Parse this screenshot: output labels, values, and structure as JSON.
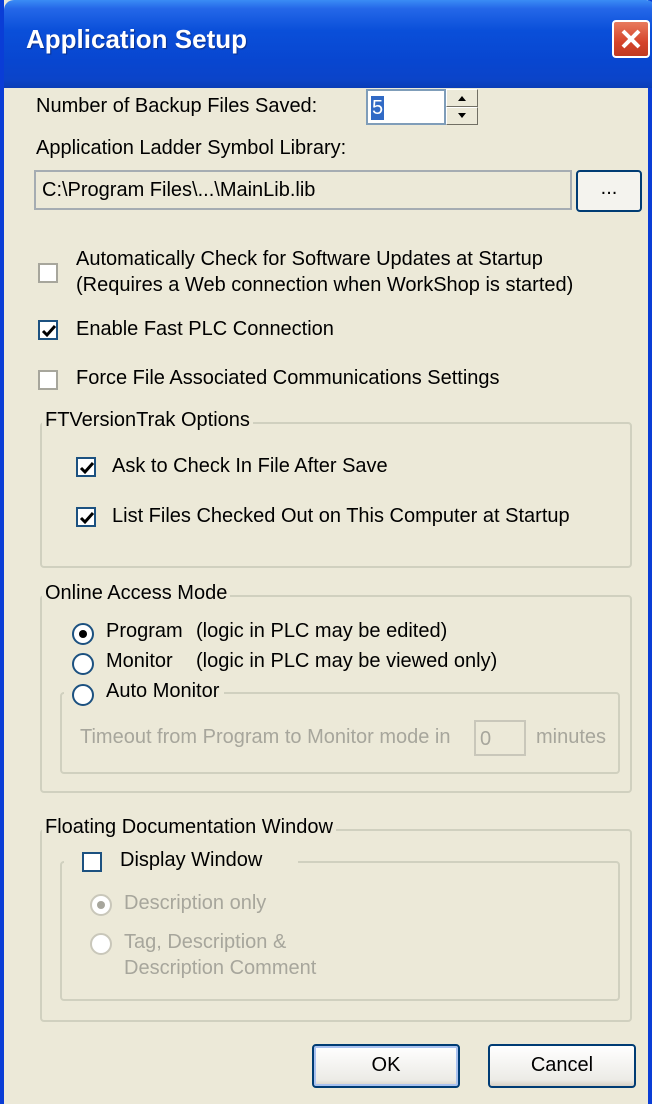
{
  "window": {
    "title": "Application Setup"
  },
  "backup": {
    "label": "Number of Backup Files Saved:",
    "value": "5"
  },
  "library": {
    "label": "Application Ladder Symbol Library:",
    "path": "C:\\Program Files\\...\\MainLib.lib",
    "browse_label": "..."
  },
  "options": {
    "auto_update": {
      "label_line1": "Automatically Check for Software Updates at Startup",
      "label_line2": "(Requires a Web connection when WorkShop is started)",
      "checked": false
    },
    "fast_plc": {
      "label": "Enable Fast PLC Connection",
      "checked": true
    },
    "force_file": {
      "label": "Force File Associated Communications Settings",
      "checked": false
    }
  },
  "ftversiontrak": {
    "title": "FTVersionTrak Options",
    "checkin": {
      "label": "Ask to Check In File After Save",
      "checked": true
    },
    "list_files": {
      "label": "List Files Checked Out on This Computer at Startup",
      "checked": true
    }
  },
  "online_access": {
    "title": "Online Access Mode",
    "program": {
      "label": "Program",
      "desc": "(logic in PLC may be edited)",
      "selected": true
    },
    "monitor": {
      "label": "Monitor",
      "desc": "(logic in PLC may be viewed only)",
      "selected": false
    },
    "auto_monitor": {
      "label": "Auto Monitor",
      "selected": false
    },
    "timeout_label": "Timeout from Program to Monitor mode in",
    "timeout_value": "0",
    "timeout_unit": "minutes"
  },
  "floating_doc": {
    "title": "Floating Documentation Window",
    "display": {
      "label": "Display Window",
      "checked": false
    },
    "desc_only": {
      "label": "Description only",
      "selected": true
    },
    "tag_desc": {
      "label_line1": "Tag, Description &",
      "label_line2": "Description Comment",
      "selected": false
    }
  },
  "buttons": {
    "ok": "OK",
    "cancel": "Cancel"
  },
  "colors": {
    "titlebar": "#0A4FD9",
    "face": "#ECE9D8",
    "selection": "#316AC5",
    "close": "#D5442A"
  }
}
